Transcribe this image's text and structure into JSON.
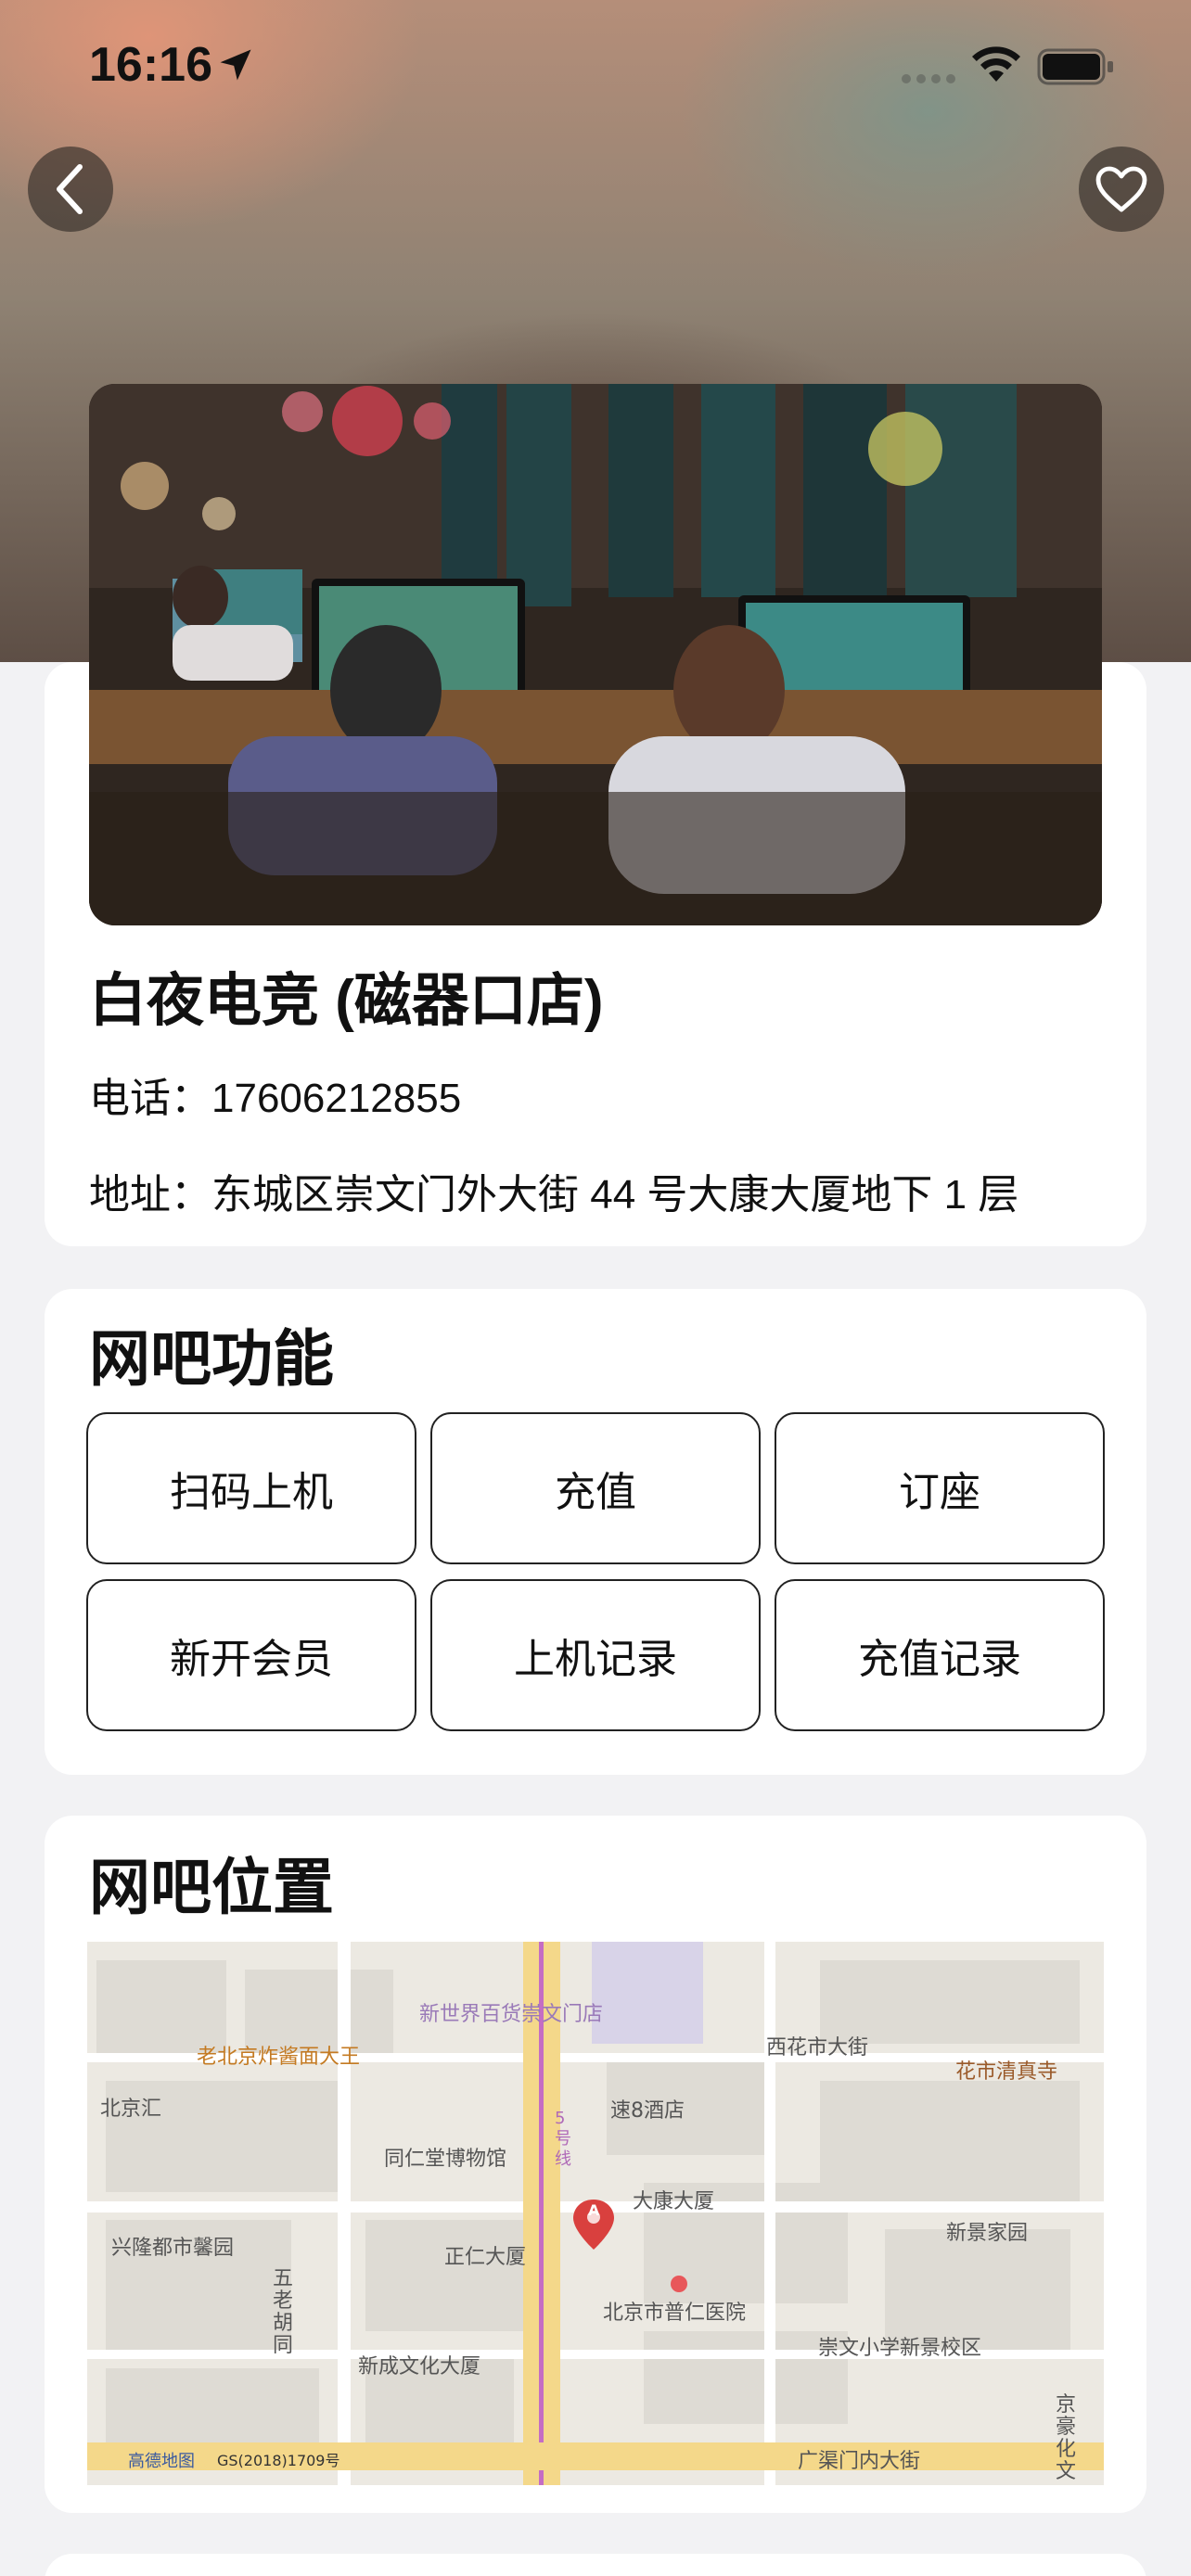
{
  "status_bar": {
    "time": "16:16"
  },
  "icons": {
    "back": "chevron-left-icon",
    "favorite": "heart-icon",
    "location": "location-arrow-icon",
    "wifi": "wifi-icon",
    "battery": "battery-icon"
  },
  "shop": {
    "name": "白夜电竞 (磁器口店)",
    "phone_label": "电话：",
    "phone": "17606212855",
    "address_label": "地址：",
    "address": "东城区崇文门外大街 44 号大康大厦地下 1 层"
  },
  "functions": {
    "title": "网吧功能",
    "buttons": [
      "扫码上机",
      "充值",
      "订座",
      "新开会员",
      "上机记录",
      "充值记录"
    ]
  },
  "location": {
    "title": "网吧位置",
    "map_labels": [
      "新世界百货崇文门店",
      "老北京炸酱面大王",
      "北京汇",
      "同仁堂博物馆",
      "速8酒店",
      "西花市大街",
      "花市清真寺",
      "大康大厦",
      "兴隆都市馨园",
      "五老胡同",
      "正仁大厦",
      "新景家园",
      "北京市普仁医院",
      "崇文小学新景校区",
      "新成文化大厦",
      "京豪化文",
      "广渠门内大街",
      "5号线",
      "GS(2018)1709号",
      "高德地图"
    ],
    "marker": "A"
  },
  "colors": {
    "accent": "#000000",
    "card": "#ffffff",
    "background": "#f2f2f4"
  }
}
